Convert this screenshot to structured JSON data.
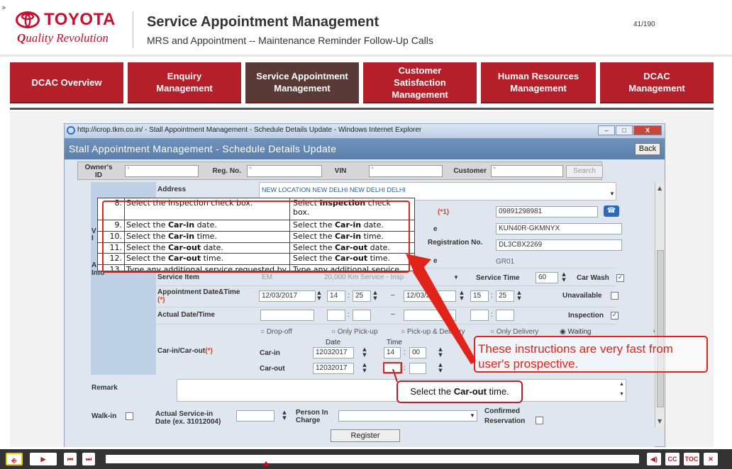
{
  "header": {
    "expander": "»",
    "logo_word": "TOYOTA",
    "logo_tagline_q": "Q",
    "logo_tagline_rest": "uality Revolution",
    "title": "Service Appointment Management",
    "subtitle": "MRS and Appointment -- Maintenance Reminder Follow-Up Calls",
    "page_count": "41/190"
  },
  "nav": {
    "tabs": [
      {
        "label": "DCAC Overview",
        "active": false
      },
      {
        "label": "Enquiry\nManagement",
        "active": false
      },
      {
        "label": "Service Appointment\nManagement",
        "active": true
      },
      {
        "label": "Customer\nSatisfaction\nManagement",
        "active": false
      },
      {
        "label": "Human Resources\nManagement",
        "active": false
      },
      {
        "label": "DCAC\nManagement",
        "active": false
      }
    ]
  },
  "ie": {
    "window_title": "http://icrop.tkm.co.in/ - Stall Appointment Management - Schedule Details Update - Windows Internet Explorer",
    "btn_min": "–",
    "btn_max": "□",
    "btn_close": "X"
  },
  "app": {
    "title": "Stall Appointment Management - Schedule Details Update",
    "back_label": "Back",
    "search": {
      "owner_label": "Owner's\nID",
      "owner_value": "*",
      "reg_label": "Reg. No.",
      "reg_value": "*",
      "vin_label": "VIN",
      "vin_value": "*",
      "customer_label": "Customer",
      "customer_value": "*",
      "search_label": "Search"
    },
    "form": {
      "address_label": "Address",
      "address_value": "NEW LOCATION NEW DELHI NEW DELHI DELHI",
      "phone_label": "(*1)",
      "phone_value": "09891298981",
      "e_label": "e",
      "model_value": "KUN40R-GKMNYX",
      "registration_label": "Registration No.",
      "registration_value": "DL3CBX2269",
      "e2_label": "e",
      "grade_value": "GR01",
      "left_v_label": "V",
      "left_i_label": "I",
      "left_a_label": "A",
      "left_info_label": "Info",
      "service_item_label": "Service Item",
      "service_item_value": "EM",
      "service_item_desc": "20,000 Km Service - Insp",
      "service_time_label": "Service Time",
      "service_time_value": "60",
      "car_wash_label": "Car Wash",
      "appointment_label": "Appointment Date&Time",
      "appointment_req": "(*)",
      "appt_date_from": "12/03/2017",
      "appt_hh_from": "14",
      "appt_mm_from": "25",
      "appt_dash": "–",
      "appt_date_to": "12/03/20",
      "appt_hh_to": "15",
      "appt_mm_to": "25",
      "unavailable_label": "Unavailable",
      "actual_label": "Actual Date/Time",
      "inspection_label": "Inspection",
      "radio_dropoff": "Drop-off",
      "radio_pickup": "Only Pick-up",
      "radio_pickup_delivery": "Pick-up & Delivery",
      "radio_delivery": "Only Delivery",
      "radio_waiting": "Waiting",
      "carinout_label": "Car-in/Car-out",
      "carinout_req": "(*)",
      "date_header": "Date",
      "time_header": "Time",
      "carin_label": "Car-in",
      "carin_date": "12032017",
      "carin_hh": "14",
      "carin_mm": "00",
      "carout_label": "Car-out",
      "carout_date": "12032017",
      "remark_label": "Remark",
      "walkin_label": "Walk-in",
      "actual_service_label": "Actual Service-in\nDate (ex. 31012004)",
      "person_label": "Person In\nCharge",
      "confirmed_label": "Confirmed\nReservation",
      "register_label": "Register",
      "time_colon": ":",
      "sb_up": "▲",
      "sb_down": "▼",
      "drop_arrow": "▼"
    }
  },
  "instructions": {
    "rows": [
      {
        "num": "8.",
        "a": "Select the Inspection check box.",
        "b_pre": "Select ",
        "b_bold": "Inspection",
        "b_post": " check box."
      },
      {
        "num": "9.",
        "a_pre": "Select the ",
        "a_bold": "Car-in",
        "a_post": " date.",
        "b_pre": "Select the ",
        "b_bold": "Car-in",
        "b_post": " date."
      },
      {
        "num": "10.",
        "a_pre": "Select the ",
        "a_bold": "Car-in",
        "a_post": " time.",
        "b_pre": "Select the ",
        "b_bold": "Car-in",
        "b_post": " time."
      },
      {
        "num": "11.",
        "a_pre": "Select the ",
        "a_bold": "Car-out",
        "a_post": " date.",
        "b_pre": "Select the ",
        "b_bold": "Car-out",
        "b_post": " date."
      },
      {
        "num": "12.",
        "a_pre": "Select the ",
        "a_bold": "Car-out",
        "a_post": " time.",
        "b_pre": "Select the ",
        "b_bold": "Car-out",
        "b_post": " time."
      },
      {
        "num": "13.",
        "a": "Type any additional service requested by",
        "b": "Type any additional service"
      }
    ]
  },
  "callout": {
    "text": "These instructions are very fast from user's prospective."
  },
  "tooltip": {
    "pre": "Select the ",
    "bold": "Car-out",
    "post": " time."
  },
  "player": {
    "exit_icon": "⎆",
    "play_icon": "▶",
    "prev_icon": "⏮",
    "next_icon": "⏭",
    "audio_icon": "◀)",
    "cc": "CC",
    "toc": "TOC",
    "close": "✕",
    "progress": 0.3
  },
  "colors": {
    "brand_red": "#b51f2a",
    "active_tab": "#5a3a36",
    "annotation_red": "#e2231a"
  }
}
